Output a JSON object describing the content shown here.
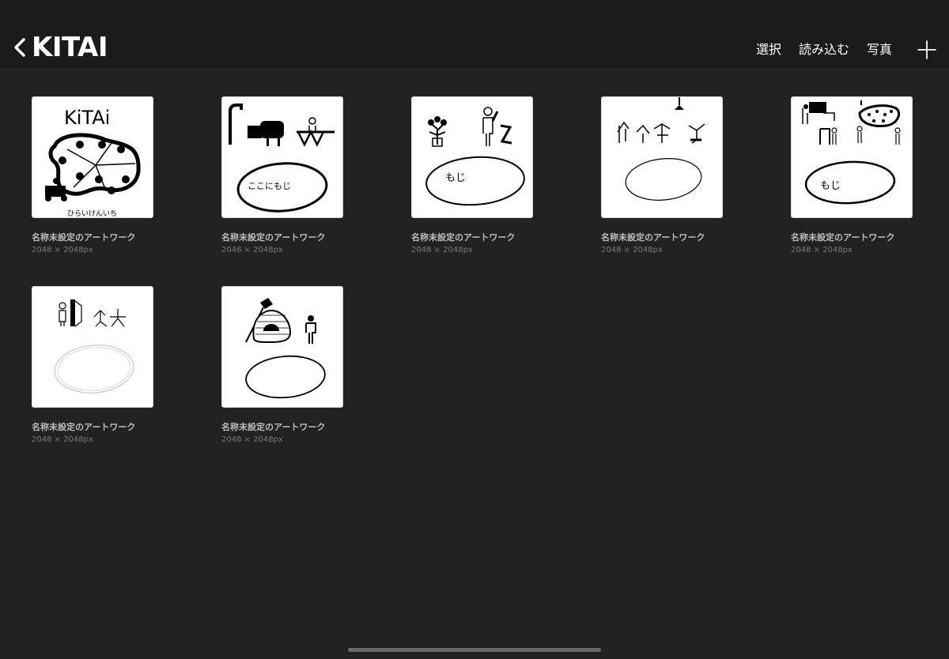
{
  "header": {
    "title": "KITAI",
    "actions": {
      "select": "選択",
      "import": "読み込む",
      "photo": "写真"
    }
  },
  "artworks": [
    {
      "name": "名称未設定のアートワーク",
      "size": "2048 × 2048px",
      "thumb_text": [
        "KiTAi",
        "ひらいけんいち"
      ]
    },
    {
      "name": "名称未設定のアートワーク",
      "size": "2048 × 2048px",
      "thumb_text": [
        "ここにもじ"
      ]
    },
    {
      "name": "名称未設定のアートワーク",
      "size": "2048 × 2048px",
      "thumb_text": [
        "もじ"
      ]
    },
    {
      "name": "名称未設定のアートワーク",
      "size": "2048 × 2048px",
      "thumb_text": []
    },
    {
      "name": "名称未設定のアートワーク",
      "size": "2048 × 2048px",
      "thumb_text": [
        "もじ"
      ]
    },
    {
      "name": "名称未設定のアートワーク",
      "size": "2048 × 2048px",
      "thumb_text": []
    },
    {
      "name": "名称未設定のアートワーク",
      "size": "2048 × 2048px",
      "thumb_text": []
    }
  ]
}
